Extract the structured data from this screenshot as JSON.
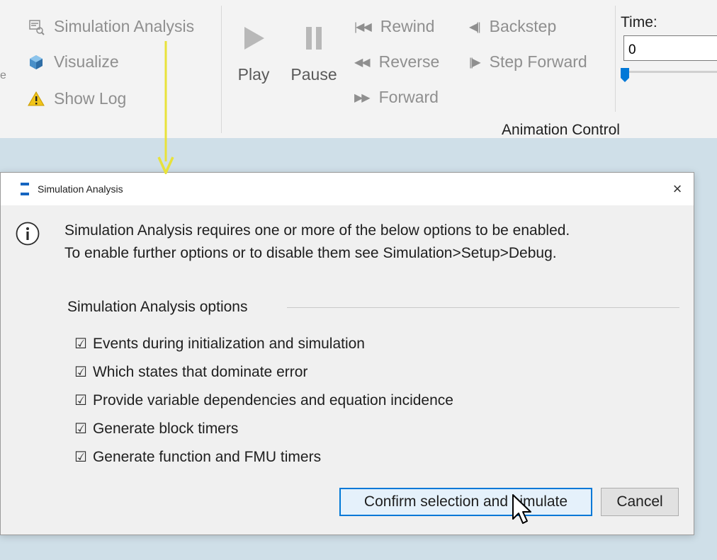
{
  "ribbon": {
    "edge_char": "e",
    "simulation_analysis": "Simulation Analysis",
    "visualize": "Visualize",
    "show_log": "Show Log",
    "play": "Play",
    "pause": "Pause",
    "rewind": "Rewind",
    "reverse": "Reverse",
    "forward": "Forward",
    "backstep": "Backstep",
    "step_forward": "Step Forward",
    "time_label": "Time:",
    "time_value": "0",
    "group_label": "Animation Control"
  },
  "dialog": {
    "title": "Simulation Analysis",
    "close": "×",
    "message_line1": "Simulation Analysis requires one or more of the below options to be enabled.",
    "message_line2": "To enable further options or to disable them see Simulation>Setup>Debug.",
    "group_title": "Simulation Analysis options",
    "options": [
      {
        "label": "Events during initialization and simulation",
        "checked": true
      },
      {
        "label": "Which states that dominate error",
        "checked": true
      },
      {
        "label": "Provide variable dependencies and equation incidence",
        "checked": true
      },
      {
        "label": "Generate block timers",
        "checked": true
      },
      {
        "label": "Generate function and FMU timers",
        "checked": true
      }
    ],
    "confirm_label": "Confirm selection and simulate",
    "cancel_label": "Cancel"
  },
  "colors": {
    "accent": "#0078d7",
    "arrow": "#e8e23a",
    "warning": "#f0c419",
    "desktop": "#cfdfe8"
  },
  "icons": {
    "checkbox": "☑",
    "fast_back": "◀◀",
    "back": "«",
    "fwd": "»"
  }
}
